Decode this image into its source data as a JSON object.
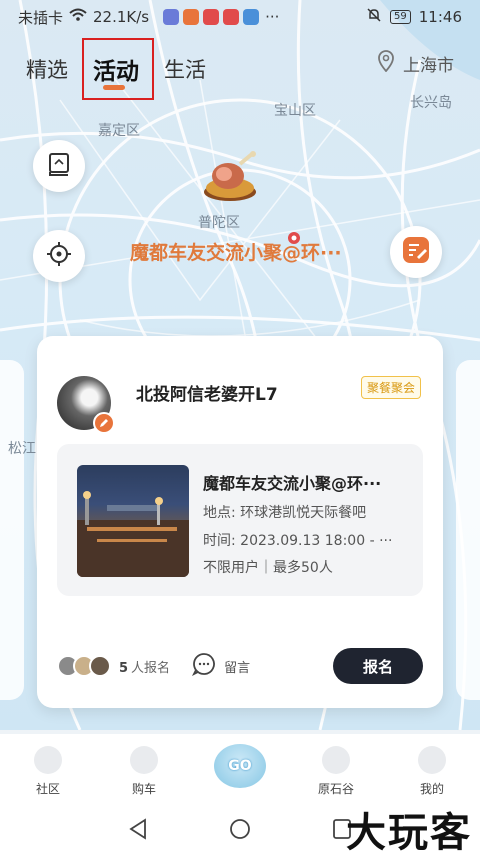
{
  "status_bar": {
    "carrier": "未插卡",
    "speed": "22.1K/s",
    "battery": "59",
    "time": "11:46"
  },
  "tabs": [
    {
      "label": "精选"
    },
    {
      "label": "活动"
    },
    {
      "label": "生活"
    }
  ],
  "city": "上海市",
  "map_labels": {
    "l1": "宝山区",
    "l2": "长兴岛",
    "l3": "嘉定区",
    "l4": "普陀区",
    "l5": "松江"
  },
  "event_pin_label": "魔都车友交流小聚@环···",
  "card": {
    "user_name": "北投阿信老婆开L7",
    "tag": "聚餐聚会",
    "event": {
      "title": "魔都车友交流小聚@环···",
      "location": "地点: 环球港凯悦天际餐吧",
      "time": "时间: 2023.09.13 18:00 - ···",
      "limit": "不限用户｜最多50人"
    },
    "signup_count": "5",
    "signup_suffix": "人报名",
    "comment_label": "留言",
    "signup_button": "报名"
  },
  "bottom_nav": [
    {
      "label": "社区"
    },
    {
      "label": "购车"
    },
    {
      "label": "GO"
    },
    {
      "label": "原石谷"
    },
    {
      "label": "我的"
    }
  ],
  "watermark": "大玩客",
  "colors": {
    "accent": "#e8743b",
    "tab_highlight": "#d92020",
    "tag_border": "#f1c14a",
    "button_dark": "#1f2430"
  }
}
